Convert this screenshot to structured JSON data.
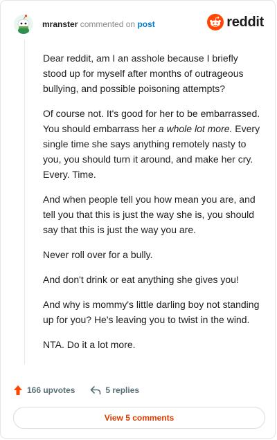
{
  "comment": {
    "author": "mranster",
    "action_text": "commented on",
    "post_link": "post",
    "brand": "reddit",
    "paragraphs": [
      {
        "parts": [
          {
            "t": "Dear reddit, am I an asshole because I briefly stood up for myself after months of outrageous bullying, and possible poisoning attempts?",
            "em": false
          }
        ]
      },
      {
        "parts": [
          {
            "t": "Of course not. It's good for her to be embarrassed. You should embarrass her ",
            "em": false
          },
          {
            "t": "a whole lot more.",
            "em": true
          },
          {
            "t": " Every single time she says anything remotely nasty to you, you should turn it around, and make her cry. Every. Time.",
            "em": false
          }
        ]
      },
      {
        "parts": [
          {
            "t": "And when people tell you how mean you are, and tell you that this is just the way she is, you should say that this is just the way you are.",
            "em": false
          }
        ]
      },
      {
        "parts": [
          {
            "t": "Never roll over for a bully.",
            "em": false
          }
        ]
      },
      {
        "parts": [
          {
            "t": "And don't drink or eat anything she gives you!",
            "em": false
          }
        ]
      },
      {
        "parts": [
          {
            "t": "And why is mommy's little darling boy not standing up for you? He's leaving you to twist in the wind.",
            "em": false
          }
        ]
      },
      {
        "parts": [
          {
            "t": "NTA. Do it a lot more.",
            "em": false
          }
        ]
      }
    ]
  },
  "actions": {
    "upvotes": "166 upvotes",
    "replies": "5 replies"
  },
  "footer": {
    "view_comments": "View 5 comments"
  },
  "colors": {
    "brand": "#ff4500",
    "link": "#0079d3",
    "view_button_text": "#d93a00"
  },
  "icons": {
    "avatar": "snoo-avatar",
    "logo": "reddit-logo-icon",
    "upvote": "upvote-arrow-icon",
    "reply": "reply-arrow-icon"
  }
}
